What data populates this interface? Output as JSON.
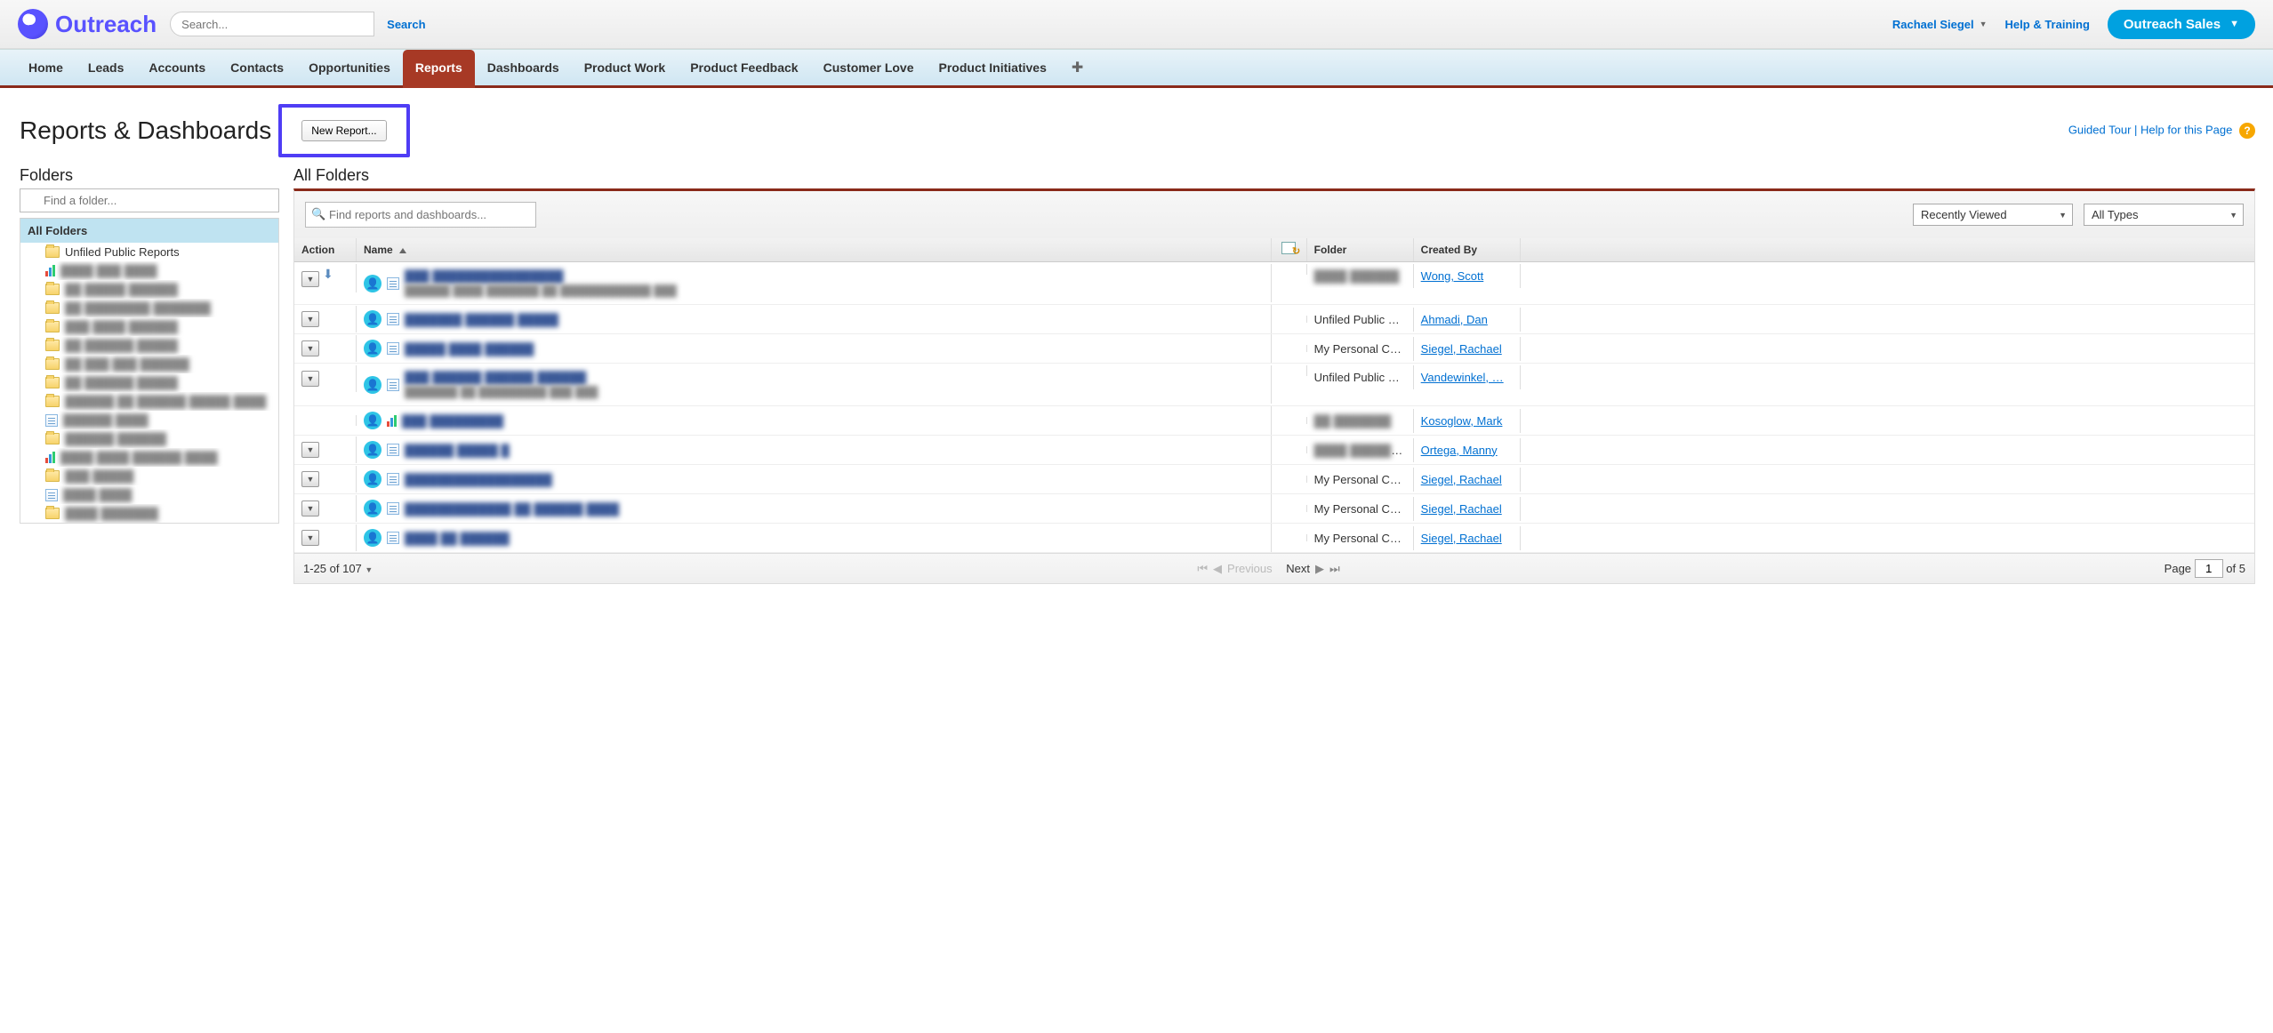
{
  "header": {
    "logo_text": "Outreach",
    "search_placeholder": "Search...",
    "search_button": "Search",
    "user_name": "Rachael Siegel",
    "help_link": "Help & Training",
    "app_name": "Outreach Sales"
  },
  "nav": {
    "tabs": [
      "Home",
      "Leads",
      "Accounts",
      "Contacts",
      "Opportunities",
      "Reports",
      "Dashboards",
      "Product Work",
      "Product Feedback",
      "Customer Love",
      "Product Initiatives"
    ],
    "active_index": 5
  },
  "page": {
    "title": "Reports & Dashboards",
    "new_report_btn": "New Report...",
    "guided_tour": "Guided Tour",
    "help_for_page": "Help for this Page"
  },
  "folders": {
    "heading": "Folders",
    "find_placeholder": "Find a folder...",
    "root": "All Folders",
    "items": [
      {
        "type": "folder",
        "label": "Unfiled Public Reports",
        "clear": true
      },
      {
        "type": "chart",
        "label": "████ ███ ████"
      },
      {
        "type": "folder",
        "label": "██ █████ ██████"
      },
      {
        "type": "folder",
        "label": "██ ████████ ███████"
      },
      {
        "type": "folder",
        "label": "███ ████ ██████"
      },
      {
        "type": "folder",
        "label": "██ ██████ █████"
      },
      {
        "type": "folder",
        "label": "██ ███ ███ ██████"
      },
      {
        "type": "folder",
        "label": "██ ██████ █████"
      },
      {
        "type": "folder",
        "label": "██████ ██ ██████ █████ ████"
      },
      {
        "type": "report",
        "label": "██████ ████"
      },
      {
        "type": "folder",
        "label": "██████ ██████"
      },
      {
        "type": "chart",
        "label": "████ ████ ██████ ████"
      },
      {
        "type": "folder",
        "label": "███ █████"
      },
      {
        "type": "report",
        "label": "████ ████"
      },
      {
        "type": "folder",
        "label": "████ ███████"
      }
    ]
  },
  "main": {
    "heading": "All Folders",
    "find_placeholder": "Find reports and dashboards...",
    "view_filter": "Recently Viewed",
    "type_filter": "All Types",
    "columns": {
      "action": "Action",
      "name": "Name",
      "folder": "Folder",
      "created_by": "Created By"
    },
    "rows": [
      {
        "action_dd": true,
        "download": true,
        "tall": true,
        "icon": "doc",
        "name_blur": "███ ████████████████",
        "desc_blur": "██████ ████ ███████ ██ ████████████ ███",
        "folder_blur": "████ ██████",
        "creator": "Wong, Scott"
      },
      {
        "action_dd": true,
        "icon": "doc",
        "name_blur": "███████ ██████ █████",
        "folder": "Unfiled Public …",
        "creator": "Ahmadi, Dan"
      },
      {
        "action_dd": true,
        "icon": "doc",
        "name_blur": "█████ ████ ██████",
        "folder": "My Personal C…",
        "creator": "Siegel, Rachael"
      },
      {
        "action_dd": true,
        "tall": true,
        "icon": "doc",
        "name_blur": "███ ██████ ██████ ██████",
        "desc_blur": "███████ ██ █████████ ███ ███",
        "folder": "Unfiled Public …",
        "creator": "Vandewinkel, …"
      },
      {
        "action_dd": false,
        "icon": "chart",
        "name_blur": "███ █████████",
        "folder_blur": "██ ███████",
        "creator": "Kosoglow, Mark"
      },
      {
        "action_dd": true,
        "icon": "doc",
        "name_blur": "██████ █████ █",
        "folder_blur": "████ ████████",
        "creator": "Ortega, Manny"
      },
      {
        "action_dd": true,
        "icon": "doc",
        "name_blur": "██████████████████",
        "folder": "My Personal C…",
        "creator": "Siegel, Rachael"
      },
      {
        "action_dd": true,
        "icon": "doc",
        "name_blur": "█████████████ ██ ██████ ████",
        "folder": "My Personal C…",
        "creator": "Siegel, Rachael"
      },
      {
        "action_dd": true,
        "icon": "doc",
        "name_blur": "████ ██ ██████",
        "folder": "My Personal C…",
        "creator": "Siegel, Rachael"
      }
    ],
    "footer": {
      "range_text": "1-25 of 107",
      "prev": "Previous",
      "next": "Next",
      "page_label": "Page",
      "page_value": "1",
      "page_of": "of 5"
    }
  }
}
